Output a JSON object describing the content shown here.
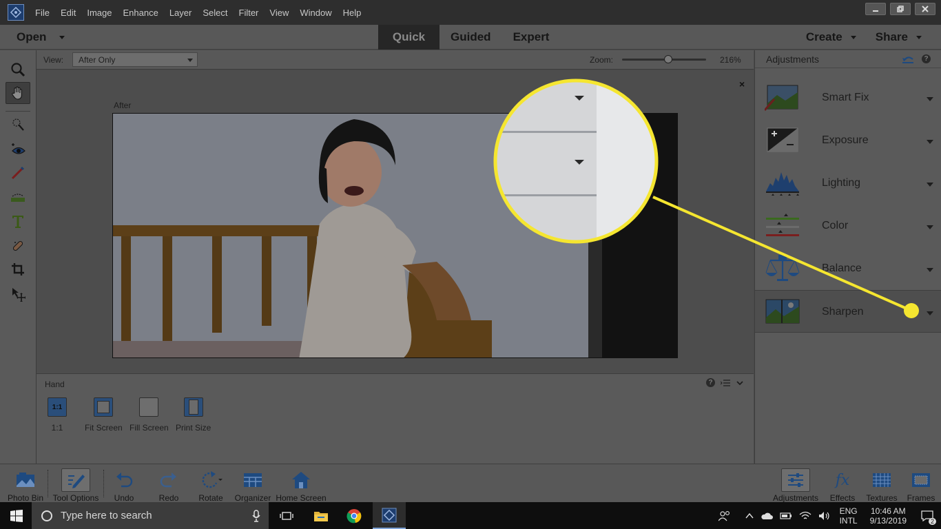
{
  "menubar": {
    "items": [
      "File",
      "Edit",
      "Image",
      "Enhance",
      "Layer",
      "Select",
      "Filter",
      "View",
      "Window",
      "Help"
    ]
  },
  "modebar": {
    "open_label": "Open",
    "tabs": [
      "Quick",
      "Guided",
      "Expert"
    ],
    "active_tab": "Quick",
    "create_label": "Create",
    "share_label": "Share"
  },
  "viewbar": {
    "view_label": "View:",
    "view_value": "After Only",
    "zoom_label": "Zoom:",
    "zoom_value": "216%",
    "zoom_level": 0.55
  },
  "canvas": {
    "after_label": "After",
    "close_label": "×"
  },
  "tool_options": {
    "title": "Hand",
    "buttons": [
      {
        "label": "1:1",
        "icon": "1:1"
      },
      {
        "label": "Fit Screen",
        "icon": "fit-screen-icon"
      },
      {
        "label": "Fill Screen",
        "icon": "fill-screen-icon"
      },
      {
        "label": "Print Size",
        "icon": "print-size-icon"
      }
    ]
  },
  "adjustments": {
    "title": "Adjustments",
    "items": [
      {
        "label": "Smart Fix",
        "icon": "smart-fix-icon"
      },
      {
        "label": "Exposure",
        "icon": "exposure-icon"
      },
      {
        "label": "Lighting",
        "icon": "lighting-icon"
      },
      {
        "label": "Color",
        "icon": "color-icon"
      },
      {
        "label": "Balance",
        "icon": "balance-icon"
      },
      {
        "label": "Sharpen",
        "icon": "sharpen-icon"
      }
    ]
  },
  "bottombar": {
    "left": [
      {
        "label": "Photo Bin",
        "icon": "photo-bin-icon"
      },
      {
        "label": "Tool Options",
        "icon": "tool-options-icon"
      },
      {
        "label": "Undo",
        "icon": "undo-icon"
      },
      {
        "label": "Redo",
        "icon": "redo-icon"
      },
      {
        "label": "Rotate",
        "icon": "rotate-icon"
      },
      {
        "label": "Organizer",
        "icon": "organizer-icon"
      },
      {
        "label": "Home Screen",
        "icon": "home-screen-icon"
      }
    ],
    "right": [
      {
        "label": "Adjustments",
        "icon": "adjustments-icon"
      },
      {
        "label": "Effects",
        "icon": "effects-icon"
      },
      {
        "label": "Textures",
        "icon": "textures-icon"
      },
      {
        "label": "Frames",
        "icon": "frames-icon"
      }
    ]
  },
  "taskbar": {
    "search_placeholder": "Type here to search",
    "lang_top": "ENG",
    "lang_bottom": "INTL",
    "time": "10:46 AM",
    "date": "9/13/2019",
    "notification_count": "2"
  },
  "colors": {
    "callout": "#f5e630",
    "accent": "#2a6db5"
  }
}
